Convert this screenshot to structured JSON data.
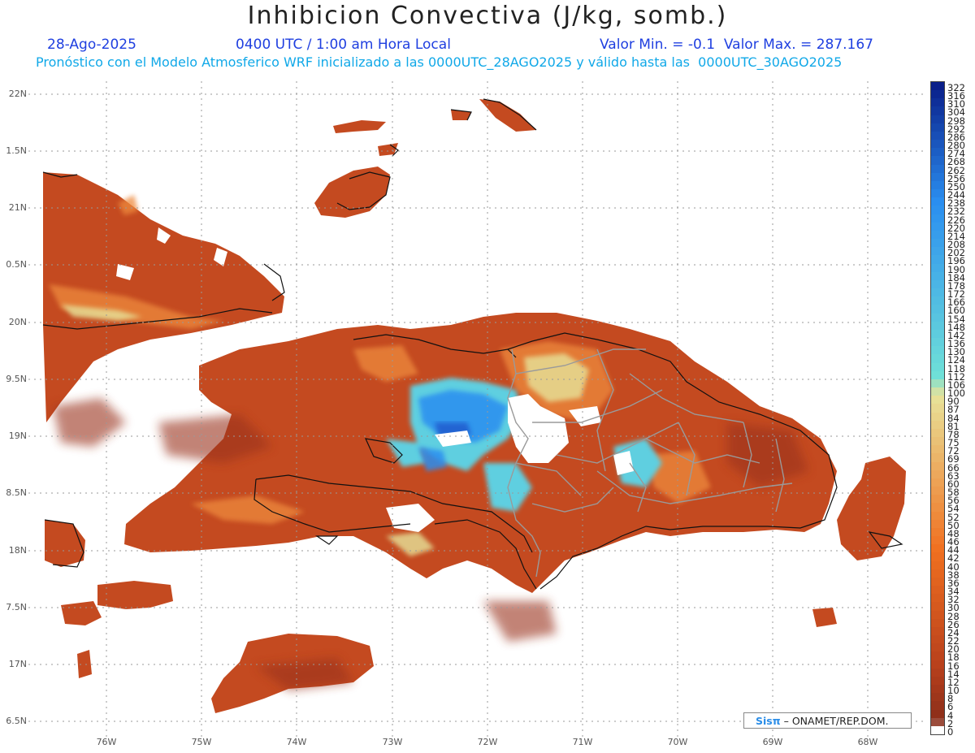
{
  "header": {
    "title": "Inhibicion Convectiva (J/kg, somb.)",
    "date": "28-Ago-2025",
    "time": "0400 UTC / 1:00 am Hora Local",
    "minmax": "Valor Min. = -0.1  Valor Max. = 287.167",
    "forecast": "Pronóstico con el Modelo Atmosferico WRF inicializado a las 0000UTC_28AGO2025 y válido hasta las  0000UTC_30AGO2025"
  },
  "axes": {
    "lat_labels": [
      "22N",
      "1.5N",
      "21N",
      "0.5N",
      "20N",
      "9.5N",
      "19N",
      "8.5N",
      "18N",
      "7.5N",
      "17N",
      "6.5N"
    ],
    "lon_labels": [
      "76W",
      "75W",
      "74W",
      "73W",
      "72W",
      "71W",
      "70W",
      "69W",
      "68W"
    ]
  },
  "colorbar": {
    "labels": [
      "322",
      "316",
      "310",
      "304",
      "298",
      "292",
      "286",
      "280",
      "274",
      "268",
      "262",
      "256",
      "250",
      "244",
      "238",
      "232",
      "226",
      "220",
      "214",
      "208",
      "202",
      "196",
      "190",
      "184",
      "178",
      "172",
      "166",
      "160",
      "154",
      "148",
      "142",
      "136",
      "130",
      "124",
      "118",
      "112",
      "106",
      "100",
      "90",
      "87",
      "84",
      "81",
      "78",
      "75",
      "72",
      "69",
      "66",
      "63",
      "60",
      "58",
      "56",
      "54",
      "52",
      "50",
      "48",
      "46",
      "44",
      "42",
      "40",
      "38",
      "36",
      "34",
      "32",
      "30",
      "28",
      "26",
      "24",
      "22",
      "20",
      "18",
      "16",
      "14",
      "12",
      "10",
      "8",
      "6",
      "4",
      "2",
      "0"
    ],
    "colors": {
      "high": "#0a1f8a",
      "mid_blue": "#2a8ef0",
      "cyan": "#6fe0d8",
      "yellow": "#e8e39a",
      "orange": "#f07020",
      "red": "#b8401c",
      "dark": "#8a2e1a"
    }
  },
  "credit": {
    "logo": "Sisπ",
    "text": "– ONAMET/REP.DOM."
  }
}
